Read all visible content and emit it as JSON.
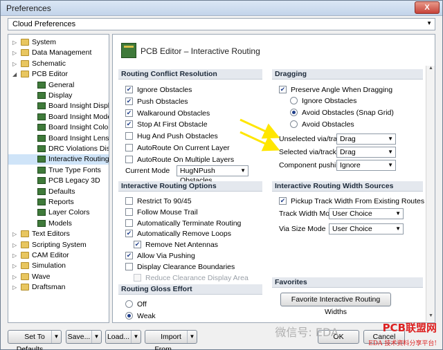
{
  "window": {
    "title": "Preferences",
    "close_label": "X"
  },
  "cloud": {
    "label": "Cloud Preferences"
  },
  "tree": [
    {
      "label": "System",
      "type": "folder",
      "exp": "▷",
      "indent": 0
    },
    {
      "label": "Data Management",
      "type": "folder",
      "exp": "▷",
      "indent": 0
    },
    {
      "label": "Schematic",
      "type": "folder",
      "exp": "▷",
      "indent": 0
    },
    {
      "label": "PCB Editor",
      "type": "folder",
      "exp": "◢",
      "indent": 0
    },
    {
      "label": "General",
      "type": "pcb",
      "indent": 1
    },
    {
      "label": "Display",
      "type": "pcb",
      "indent": 1
    },
    {
      "label": "Board Insight Display",
      "type": "pcb",
      "indent": 1
    },
    {
      "label": "Board Insight Modes",
      "type": "pcb",
      "indent": 1
    },
    {
      "label": "Board Insight Color Overrid",
      "type": "pcb",
      "indent": 1
    },
    {
      "label": "Board Insight Lens",
      "type": "pcb",
      "indent": 1
    },
    {
      "label": "DRC Violations Display",
      "type": "pcb",
      "indent": 1
    },
    {
      "label": "Interactive Routing",
      "type": "pcb",
      "indent": 1,
      "selected": true
    },
    {
      "label": "True Type Fonts",
      "type": "pcb",
      "indent": 1
    },
    {
      "label": "PCB Legacy 3D",
      "type": "pcb",
      "indent": 1
    },
    {
      "label": "Defaults",
      "type": "pcb",
      "indent": 1
    },
    {
      "label": "Reports",
      "type": "pcb",
      "indent": 1
    },
    {
      "label": "Layer Colors",
      "type": "pcb",
      "indent": 1
    },
    {
      "label": "Models",
      "type": "pcb",
      "indent": 1
    },
    {
      "label": "Text Editors",
      "type": "folder",
      "exp": "▷",
      "indent": 0
    },
    {
      "label": "Scripting System",
      "type": "folder",
      "exp": "▷",
      "indent": 0
    },
    {
      "label": "CAM Editor",
      "type": "folder",
      "exp": "▷",
      "indent": 0
    },
    {
      "label": "Simulation",
      "type": "folder",
      "exp": "▷",
      "indent": 0
    },
    {
      "label": "Wave",
      "type": "folder",
      "exp": "▷",
      "indent": 0
    },
    {
      "label": "Draftsman",
      "type": "folder",
      "exp": "▷",
      "indent": 0
    }
  ],
  "header": {
    "title": "PCB Editor – Interactive Routing"
  },
  "conflict": {
    "title": "Routing Conflict Resolution",
    "items": [
      {
        "label": "Ignore Obstacles",
        "checked": true
      },
      {
        "label": "Push Obstacles",
        "checked": true
      },
      {
        "label": "Walkaround Obstacles",
        "checked": true
      },
      {
        "label": "Stop At First Obstacle",
        "checked": true
      },
      {
        "label": "Hug And Push Obstacles",
        "checked": false
      },
      {
        "label": "AutoRoute On Current Layer",
        "checked": false
      },
      {
        "label": "AutoRoute On Multiple Layers",
        "checked": false
      }
    ],
    "current_mode_label": "Current Mode",
    "current_mode_value": "HugNPush Obstacles"
  },
  "options": {
    "title": "Interactive Routing Options",
    "items": [
      {
        "label": "Restrict To 90/45",
        "checked": false,
        "indent": 0
      },
      {
        "label": "Follow Mouse Trail",
        "checked": false,
        "indent": 0
      },
      {
        "label": "Automatically Terminate Routing",
        "checked": false,
        "indent": 0
      },
      {
        "label": "Automatically Remove Loops",
        "checked": true,
        "indent": 0
      },
      {
        "label": "Remove Net Antennas",
        "checked": true,
        "indent": 1
      },
      {
        "label": "Allow Via Pushing",
        "checked": true,
        "indent": 0
      },
      {
        "label": "Display Clearance Boundaries",
        "checked": false,
        "indent": 0
      },
      {
        "label": "Reduce Clearance Display Area",
        "checked": false,
        "indent": 1,
        "disabled": true
      }
    ]
  },
  "gloss": {
    "title": "Routing Gloss Effort",
    "items": [
      {
        "label": "Off",
        "on": false
      },
      {
        "label": "Weak",
        "on": true
      }
    ]
  },
  "dragging": {
    "title": "Dragging",
    "preserve_label": "Preserve Angle When Dragging",
    "preserve_checked": true,
    "radios": [
      {
        "label": "Ignore Obstacles",
        "on": false
      },
      {
        "label": "Avoid Obstacles (Snap Grid)",
        "on": true
      },
      {
        "label": "Avoid Obstacles",
        "on": false
      }
    ],
    "unselected_label": "Unselected via/track",
    "unselected_value": "Drag",
    "selected_label": "Selected via/track",
    "selected_value": "Drag",
    "component_label": "Component pushing",
    "component_value": "Ignore"
  },
  "width": {
    "title": "Interactive Routing Width Sources",
    "pickup_label": "Pickup Track Width From Existing Routes",
    "pickup_checked": true,
    "track_mode_label": "Track Width Mode",
    "track_mode_value": "User Choice",
    "via_mode_label": "Via Size Mode",
    "via_mode_value": "User Choice"
  },
  "favorites": {
    "title": "Favorites",
    "button_label": "Favorite Interactive Routing Widths"
  },
  "footer": {
    "set_defaults": "Set To Defaults",
    "save": "Save...",
    "load": "Load...",
    "import": "Import From...",
    "ok": "OK",
    "cancel": "Cancel"
  },
  "watermark": {
    "text": "微信号: EDA",
    "logo": "PCB联盟网",
    "sub": "EDA 技术资料分享平台!"
  },
  "colors": {
    "accent": "#1e3d8a",
    "arrow": "#ffe600",
    "selection": "#cfe4f8"
  }
}
